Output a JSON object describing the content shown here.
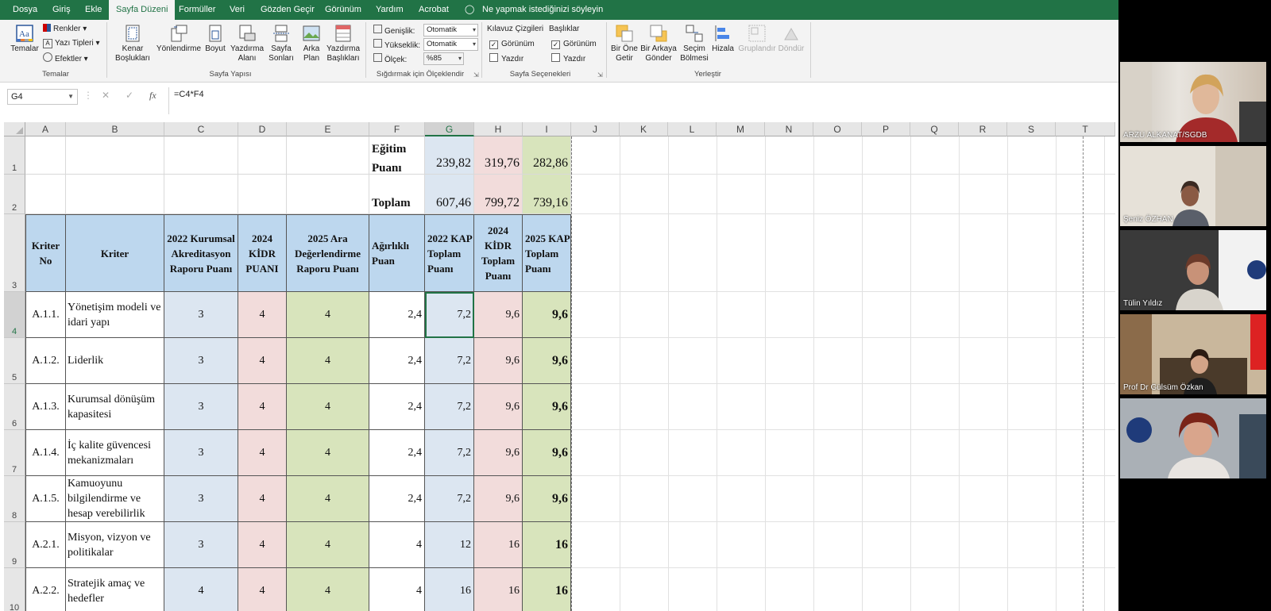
{
  "ribbon": {
    "tabs": [
      "Dosya",
      "Giriş",
      "Ekle",
      "Sayfa Düzeni",
      "Formüller",
      "Veri",
      "Gözden Geçir",
      "Görünüm",
      "Yardım",
      "Acrobat"
    ],
    "tell_me": "Ne yapmak istediğinizi söyleyin",
    "themes": {
      "big": "Temalar",
      "colors": "Renkler",
      "fonts": "Yazı Tipleri",
      "effects": "Efektler",
      "group": "Temalar"
    },
    "page_setup": {
      "margins": "Kenar Boşlukları",
      "orientation": "Yönlendirme",
      "size": "Boyut",
      "print_area": "Yazdırma Alanı",
      "breaks": "Sayfa Sonları",
      "background": "Arka Plan",
      "print_titles": "Yazdırma Başlıkları",
      "group": "Sayfa Yapısı"
    },
    "scale_to_fit": {
      "width_label": "Genişlik:",
      "width_value": "Otomatik",
      "height_label": "Yükseklik:",
      "height_value": "Otomatik",
      "scale_label": "Ölçek:",
      "scale_value": "%85",
      "group": "Sığdırmak için Ölçeklendir"
    },
    "sheet_options": {
      "gridlines": "Kılavuz Çizgileri",
      "headings": "Başlıklar",
      "view": "Görünüm",
      "print": "Yazdır",
      "group": "Sayfa Seçenekleri"
    },
    "arrange": {
      "bring_forward": "Bir Öne Getir",
      "send_backward": "Bir Arkaya Gönder",
      "selection_pane": "Seçim Bölmesi",
      "align": "Hizala",
      "group_btn": "Gruplandır",
      "rotate": "Döndür",
      "group": "Yerleştir"
    }
  },
  "formula_bar": {
    "name_box": "G4",
    "formula": "=C4*F4",
    "fx": "fx"
  },
  "columns": [
    "A",
    "B",
    "C",
    "D",
    "E",
    "F",
    "G",
    "H",
    "I",
    "J",
    "K",
    "L",
    "M",
    "N",
    "O",
    "P",
    "Q",
    "R",
    "S",
    "T"
  ],
  "rows": [
    "1",
    "2",
    "3",
    "4",
    "5",
    "6",
    "7",
    "8",
    "9",
    "10"
  ],
  "sheet": {
    "row1": {
      "label": "Eğitim Puanı",
      "g": "239,82",
      "h": "319,76",
      "i": "282,86"
    },
    "row2": {
      "label": "Toplam",
      "g": "607,46",
      "h": "799,72",
      "i": "739,16"
    },
    "headers": {
      "a": "Kriter No",
      "b": "Kriter",
      "c": "2022 Kurumsal Akreditasyon Raporu Puanı",
      "d": "2024 KİDR PUANI",
      "e": "2025 Ara Değerlendirme Raporu Puanı",
      "f": "Ağırlıklı Puan",
      "g": "2022 KAP Toplam Puanı",
      "h": "2024 KİDR Toplam Puanı",
      "i": "2025 KAP Toplam Puanı"
    },
    "data": [
      {
        "no": "A.1.1.",
        "kriter": "Yönetişim modeli ve idari yapı",
        "c": "3",
        "d": "4",
        "e": "4",
        "f": "2,4",
        "g": "7,2",
        "h": "9,6",
        "i": "9,6"
      },
      {
        "no": "A.1.2.",
        "kriter": "Liderlik",
        "c": "3",
        "d": "4",
        "e": "4",
        "f": "2,4",
        "g": "7,2",
        "h": "9,6",
        "i": "9,6"
      },
      {
        "no": "A.1.3.",
        "kriter": "Kurumsal dönüşüm kapasitesi",
        "c": "3",
        "d": "4",
        "e": "4",
        "f": "2,4",
        "g": "7,2",
        "h": "9,6",
        "i": "9,6"
      },
      {
        "no": "A.1.4.",
        "kriter": "İç kalite güvencesi mekanizmaları",
        "c": "3",
        "d": "4",
        "e": "4",
        "f": "2,4",
        "g": "7,2",
        "h": "9,6",
        "i": "9,6"
      },
      {
        "no": "A.1.5.",
        "kriter": "Kamuoyunu bilgilendirme ve hesap verebilirlik",
        "c": "3",
        "d": "4",
        "e": "4",
        "f": "2,4",
        "g": "7,2",
        "h": "9,6",
        "i": "9,6"
      },
      {
        "no": "A.2.1.",
        "kriter": "Misyon, vizyon ve politikalar",
        "c": "3",
        "d": "4",
        "e": "4",
        "f": "4",
        "g": "12",
        "h": "16",
        "i": "16"
      },
      {
        "no": "A.2.2.",
        "kriter": "Stratejik amaç ve hedefler",
        "c": "4",
        "d": "4",
        "e": "4",
        "f": "4",
        "g": "16",
        "h": "16",
        "i": "16"
      }
    ]
  },
  "participants": [
    {
      "name": "ARZU ALKANAT/SGDB"
    },
    {
      "name": "Şeniz ÖZHAN"
    },
    {
      "name": "Tülin Yıldız"
    },
    {
      "name": "Prof Dr Gülsüm Özkan"
    },
    {
      "name": ""
    }
  ]
}
